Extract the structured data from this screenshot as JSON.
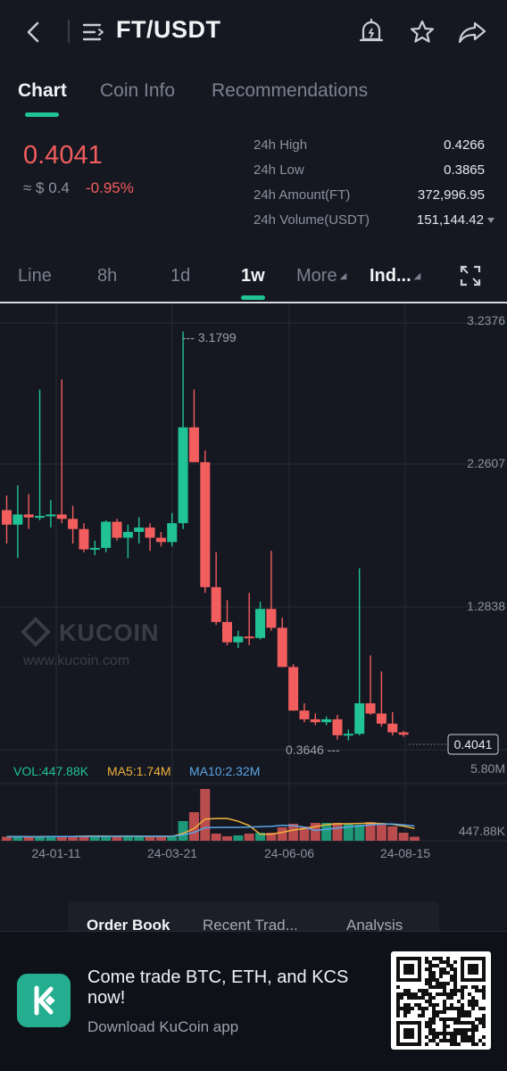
{
  "header": {
    "title": "FT/USDT",
    "icons": [
      "back-icon",
      "menu-icon",
      "alert-bell-icon",
      "star-icon",
      "share-icon"
    ]
  },
  "tabs": [
    {
      "label": "Chart",
      "active": true
    },
    {
      "label": "Coin Info",
      "active": false
    },
    {
      "label": "Recommendations",
      "active": false
    }
  ],
  "ticker": {
    "price": "0.4041",
    "approx": "≈ $ 0.4",
    "change": "-0.95%",
    "stats": [
      {
        "label": "24h High",
        "value": "0.4266"
      },
      {
        "label": "24h Low",
        "value": "0.3865"
      },
      {
        "label": "24h Amount(FT)",
        "value": "372,996.95"
      },
      {
        "label": "24h Volume(USDT)",
        "value": "151,144.42"
      }
    ]
  },
  "intervals": {
    "line": "Line",
    "h8": "8h",
    "d1": "1d",
    "w1": "1w",
    "more": "More",
    "ind": "Ind...",
    "selected": "1w"
  },
  "colors": {
    "up": "#21c395",
    "down": "#f25d5d",
    "accent": "#21c395",
    "ma5": "#f0b23c",
    "ma10": "#5aa7e6"
  },
  "chart_data": {
    "type": "candlestick",
    "price_axis": [
      "3.2376",
      "2.2607",
      "1.2838"
    ],
    "volume_axis": [
      "5.80M",
      "447.88K"
    ],
    "date_labels": [
      "24-01-11",
      "24-03-21",
      "24-06-06",
      "24-08-15"
    ],
    "max_label": "3.1799",
    "min_label": "0.3646",
    "last_price": "0.4041",
    "watermark": {
      "brand": "KUCOIN",
      "site": "www.kucoin.com"
    },
    "indicators": {
      "vol": "VOL:447.88K",
      "ma5": "MA5:1.74M",
      "ma10": "MA10:2.32M"
    },
    "ohlc": [
      [
        1.95,
        2.05,
        1.72,
        1.85
      ],
      [
        1.85,
        2.12,
        1.62,
        1.92
      ],
      [
        1.92,
        2.06,
        1.82,
        1.9
      ],
      [
        1.9,
        2.78,
        1.88,
        1.91
      ],
      [
        1.91,
        2.02,
        1.83,
        1.92
      ],
      [
        1.92,
        2.85,
        1.86,
        1.89
      ],
      [
        1.89,
        1.98,
        1.72,
        1.82
      ],
      [
        1.82,
        1.86,
        1.66,
        1.68
      ],
      [
        1.68,
        1.74,
        1.64,
        1.69
      ],
      [
        1.69,
        1.88,
        1.66,
        1.87
      ],
      [
        1.87,
        1.89,
        1.74,
        1.76
      ],
      [
        1.76,
        1.85,
        1.62,
        1.8
      ],
      [
        1.8,
        1.9,
        1.72,
        1.83
      ],
      [
        1.83,
        1.86,
        1.67,
        1.76
      ],
      [
        1.76,
        1.8,
        1.7,
        1.73
      ],
      [
        1.73,
        1.93,
        1.7,
        1.86
      ],
      [
        1.86,
        3.1799,
        1.82,
        2.52
      ],
      [
        2.52,
        2.78,
        2.28,
        2.28
      ],
      [
        2.28,
        2.36,
        1.38,
        1.42
      ],
      [
        1.42,
        1.66,
        1.16,
        1.18
      ],
      [
        1.18,
        1.33,
        1.02,
        1.04
      ],
      [
        1.04,
        1.12,
        1.0,
        1.08
      ],
      [
        1.08,
        1.38,
        1.02,
        1.07
      ],
      [
        1.07,
        1.32,
        1.06,
        1.27
      ],
      [
        1.27,
        1.67,
        1.12,
        1.14
      ],
      [
        1.14,
        1.21,
        0.87,
        0.87
      ],
      [
        0.87,
        0.89,
        0.57,
        0.57
      ],
      [
        0.57,
        0.62,
        0.49,
        0.51
      ],
      [
        0.51,
        0.55,
        0.47,
        0.49
      ],
      [
        0.49,
        0.53,
        0.47,
        0.51
      ],
      [
        0.51,
        0.54,
        0.37,
        0.4
      ],
      [
        0.4,
        0.44,
        0.3646,
        0.41
      ],
      [
        0.41,
        1.55,
        0.4,
        0.62
      ],
      [
        0.62,
        0.95,
        0.54,
        0.55
      ],
      [
        0.55,
        0.84,
        0.46,
        0.48
      ],
      [
        0.48,
        0.56,
        0.4,
        0.42
      ],
      [
        0.42,
        0.43,
        0.39,
        0.4041
      ]
    ],
    "volumes_m": [
      0.45,
      0.5,
      0.4,
      0.45,
      0.55,
      0.5,
      0.5,
      0.55,
      0.5,
      0.5,
      0.45,
      0.55,
      0.5,
      0.45,
      0.5,
      0.45,
      2.2,
      3.2,
      5.8,
      0.8,
      0.5,
      0.6,
      0.8,
      0.9,
      0.9,
      1.5,
      1.9,
      1.6,
      2.0,
      2.0,
      2.0,
      1.9,
      1.8,
      2.1,
      1.8,
      1.6,
      0.9,
      0.45
    ]
  },
  "bottom_tabs": [
    {
      "label": "Order Book",
      "active": true
    },
    {
      "label": "Recent Trad...",
      "active": false
    },
    {
      "label": "Analysis",
      "active": false
    }
  ],
  "banner": {
    "title": "Come trade BTC, ETH, and KCS now!",
    "subtitle": "Download KuCoin app"
  }
}
